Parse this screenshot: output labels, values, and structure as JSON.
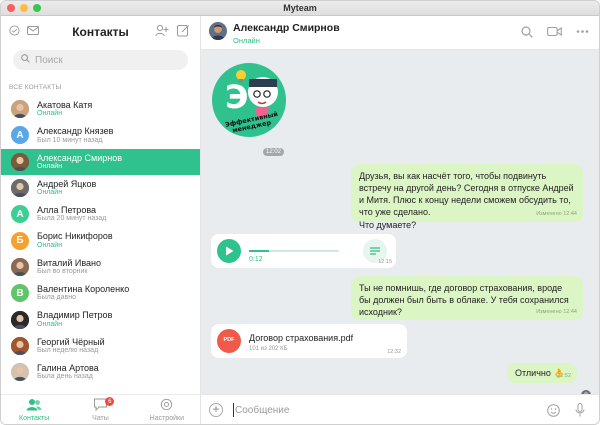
{
  "window": {
    "title": "Myteam"
  },
  "sidebar": {
    "title": "Контакты",
    "search_placeholder": "Поиск",
    "section_label": "ВСЕ КОНТАКТЫ",
    "contacts": [
      {
        "name": "Акатова Катя",
        "status": "Онлайн",
        "online": true,
        "avatar": "photo",
        "color": "#c9a27e"
      },
      {
        "name": "Александр Князев",
        "status": "Был 10 минут назад",
        "online": false,
        "avatar": "letter",
        "letter": "А",
        "color": "#5aa7e8"
      },
      {
        "name": "Александр Смирнов",
        "status": "Онлайн",
        "online": true,
        "avatar": "photo",
        "color": "#7c5a3c",
        "active": true
      },
      {
        "name": "Андрей Яцков",
        "status": "Онлайн",
        "online": true,
        "avatar": "photo",
        "color": "#6b6b6b"
      },
      {
        "name": "Алла Петрова",
        "status": "Была 20 минут назад",
        "online": false,
        "avatar": "letter",
        "letter": "А",
        "color": "#3ccf93"
      },
      {
        "name": "Борис Никифоров",
        "status": "Онлайн",
        "online": true,
        "avatar": "letter",
        "letter": "Б",
        "color": "#f5a12d"
      },
      {
        "name": "Виталий Ивано",
        "status": "Был во вторник",
        "online": false,
        "avatar": "photo",
        "color": "#8a6a55"
      },
      {
        "name": "Валентина Короленко",
        "status": "Была давно",
        "online": false,
        "avatar": "letter",
        "letter": "В",
        "color": "#5fc46a"
      },
      {
        "name": "Владимир Петров",
        "status": "Онлайн",
        "online": true,
        "avatar": "photo",
        "color": "#2a2a2a"
      },
      {
        "name": "Георгий Чёрный",
        "status": "Был неделю назад",
        "online": false,
        "avatar": "photo",
        "color": "#a0562e"
      },
      {
        "name": "Галина Артова",
        "status": "Была день назад",
        "online": false,
        "avatar": "photo",
        "color": "#d3c1b2"
      }
    ]
  },
  "tabs": [
    {
      "label": "Контакты",
      "active": true
    },
    {
      "label": "Чаты",
      "badge": "6"
    },
    {
      "label": "Настройки"
    }
  ],
  "chat": {
    "name": "Александр Смирнов",
    "status": "Онлайн",
    "sticker": {
      "line1": "Эффективный",
      "line2": "менеджер",
      "time": "12:02"
    },
    "messages": {
      "m1": {
        "text": "Друзья, вы как насчёт того, чтобы подвинуть встречу на другой день? Сегодня в отпуске Андрей и Митя. Плюс к концу недели сможем обсудить то, что уже сделано.\nЧто думаете?",
        "time": "Изменено 12:44"
      },
      "voice": {
        "duration": "0:12",
        "time": "12:15"
      },
      "m2": {
        "text": "Ты не помнишь, где договор страхования, вроде бы должен был быть в облаке. У тебя сохранился исходник?",
        "time": "Изменено 12:44"
      },
      "file": {
        "name": "Договор страхования.pdf",
        "size": "101 из 202 КБ",
        "icon_label": "PDF",
        "time": "12:32"
      },
      "m3": {
        "text": "Отлично 👌",
        "time": "12:52"
      }
    },
    "composer_placeholder": "Сообщение"
  },
  "colors": {
    "accent": "#2fc18e",
    "outgoing": "#dcf5c5",
    "pdf": "#ef5a4a"
  }
}
